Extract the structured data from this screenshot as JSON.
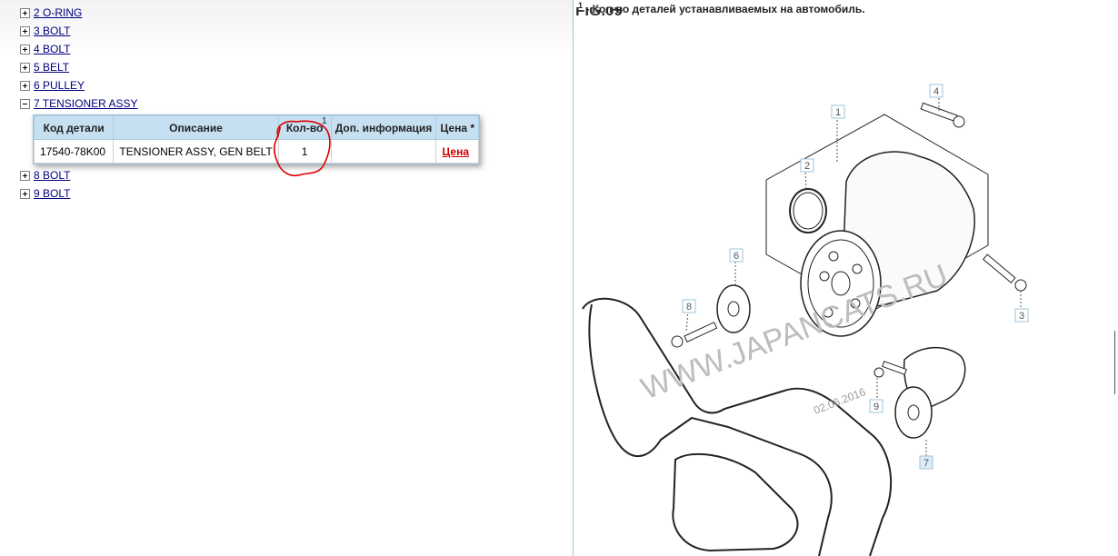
{
  "tree": {
    "items_before": [
      {
        "num": "2",
        "label": "2 O-RING"
      },
      {
        "num": "3",
        "label": "3 BOLT"
      },
      {
        "num": "4",
        "label": "4 BOLT"
      },
      {
        "num": "5",
        "label": "5 BELT"
      },
      {
        "num": "6",
        "label": "6 PULLEY"
      }
    ],
    "expanded_item": {
      "label": "7 TENSIONER ASSY"
    },
    "items_after": [
      {
        "label": "8 BOLT"
      },
      {
        "label": "9 BOLT"
      }
    ]
  },
  "parts_table": {
    "headers": {
      "code": "Код детали",
      "description": "Описание",
      "qty": "Кол-во",
      "qty_sup": "1",
      "info": "Доп. информация",
      "price": "Цена *"
    },
    "rows": [
      {
        "code": "17540-78K00",
        "description": "TENSIONER ASSY, GEN BELT",
        "qty": "1",
        "info": "",
        "price": "Цена"
      }
    ]
  },
  "annotation": {
    "color": "#dd0000"
  },
  "right_panel": {
    "footnote_sup": "1",
    "footnote": " - Кол-во деталей устанавливаемых на автомобиль.",
    "fig_title": "FIG.09",
    "watermark": "WWW.JAPANCATS.RU",
    "date": "02.06.2016",
    "callouts": [
      "1",
      "2",
      "3",
      "4",
      "6",
      "7",
      "8",
      "9"
    ]
  },
  "colors": {
    "link": "#000080",
    "price": "#cc0000",
    "header_bg": "#c7e0f1"
  }
}
